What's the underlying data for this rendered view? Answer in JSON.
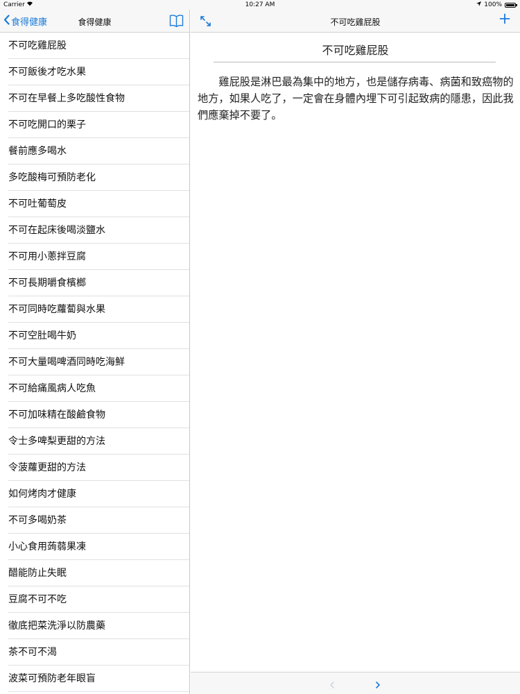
{
  "status_bar": {
    "carrier": "Carrier",
    "time": "10:27 AM",
    "battery": "100%",
    "battery_level": 1.0
  },
  "master": {
    "back_label": "食得健康",
    "title": "食得健康",
    "items": [
      {
        "label": "不可吃雞屁股"
      },
      {
        "label": "不可飯後才吃水果"
      },
      {
        "label": "不可在早餐上多吃酸性食物"
      },
      {
        "label": "不可吃開口的栗子"
      },
      {
        "label": "餐前應多喝水"
      },
      {
        "label": "多吃酸梅可預防老化"
      },
      {
        "label": "不可吐葡萄皮"
      },
      {
        "label": "不可在起床後喝淡鹽水"
      },
      {
        "label": "不可用小蔥拌豆腐"
      },
      {
        "label": "不可長期嚼食檳榔"
      },
      {
        "label": "不可同時吃蘿蔔與水果"
      },
      {
        "label": "不可空肚喝牛奶"
      },
      {
        "label": "不可大量喝啤酒同時吃海鮮"
      },
      {
        "label": "不可給痛風病人吃魚"
      },
      {
        "label": "不可加味精在酸鹼食物"
      },
      {
        "label": "令士多啤梨更甜的方法"
      },
      {
        "label": "令菠蘿更甜的方法"
      },
      {
        "label": "如何烤肉才健康"
      },
      {
        "label": "不可多喝奶茶"
      },
      {
        "label": "小心食用蒟蒻果凍"
      },
      {
        "label": "醋能防止失眠"
      },
      {
        "label": "豆腐不可不吃"
      },
      {
        "label": "徹底把菜洗淨以防農藥"
      },
      {
        "label": "茶不可不渴"
      },
      {
        "label": "波菜可預防老年眼盲"
      }
    ]
  },
  "detail": {
    "nav_title": "不可吃雞屁股",
    "heading": "不可吃雞屁股",
    "body": "雞屁股是淋巴最為集中的地方，也是儲存病毒、病菌和致癌物的地方，如果人吃了，一定會在身體內埋下可引起致病的隱患，因此我們應棄掉不要了。"
  },
  "colors": {
    "accent": "#1a7bdb",
    "bar_background": "#f7f7f7",
    "separator": "#d2d2d6"
  }
}
